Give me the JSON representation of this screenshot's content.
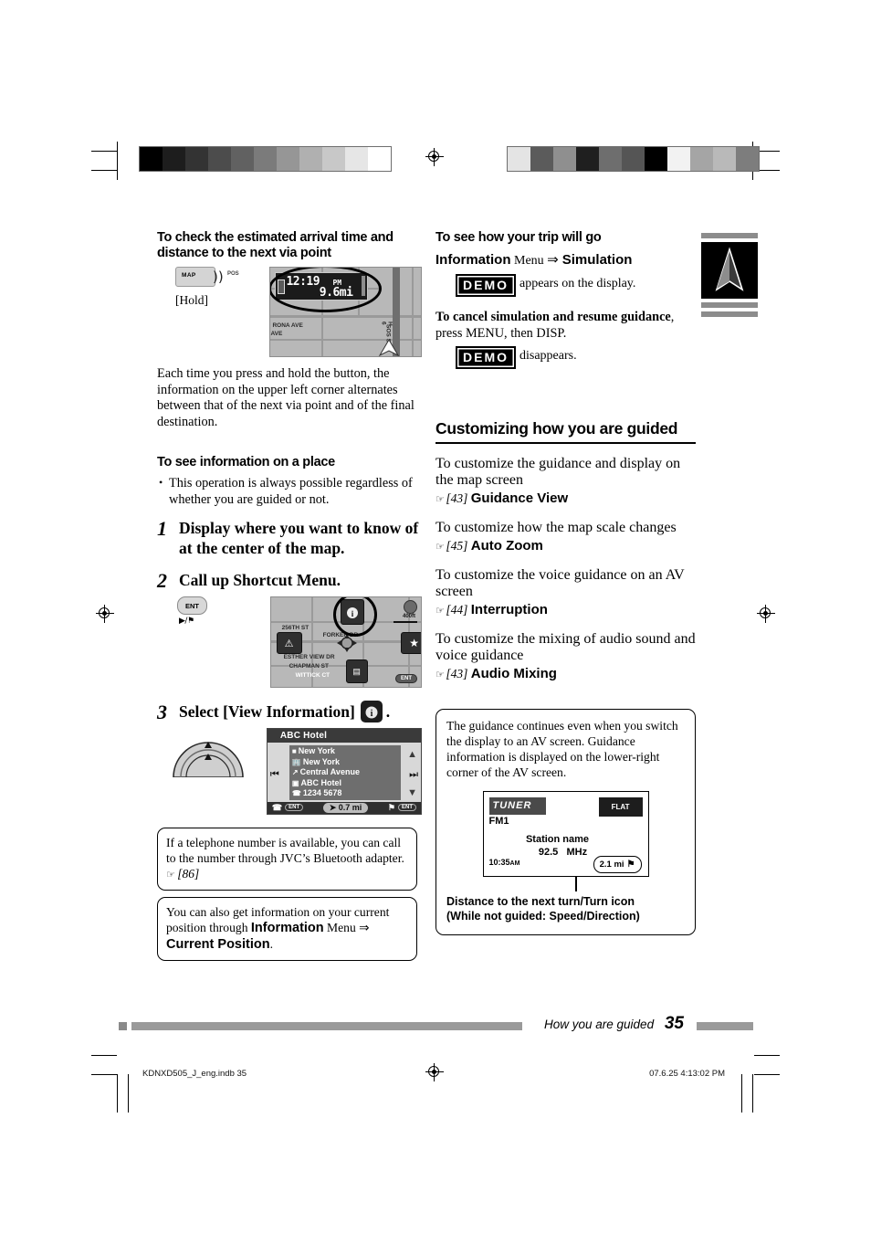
{
  "page": {
    "number": "35",
    "footer_title": "How you are guided",
    "imprint_left": "KDNXD505_J_eng.indb  35",
    "imprint_right": "07.6.25  4:13:02 PM"
  },
  "left_column": {
    "heading1": "To check the estimated arrival time and distance to the next via point",
    "map_button": {
      "label": "MAP",
      "sublabel": "POS",
      "hold": "[Hold]"
    },
    "map_shot_1": {
      "time": "12:19",
      "ampm": "PM",
      "distance": "9.6mi",
      "street_labels": [
        "RONA AVE",
        "AVE",
        "H",
        "6",
        "ST"
      ]
    },
    "paragraph1": "Each time you press and hold the button, the information on the upper left corner alternates between that of the next via point and of the final destination.",
    "heading2": "To see information on a place",
    "bullet1": "This operation is always possible regardless of whether you are guided or not.",
    "step1": {
      "num": "1",
      "text": "Display where you want to know of at the center of the map."
    },
    "step2": {
      "num": "2",
      "text": "Call up Shortcut Menu."
    },
    "ent_button": {
      "label": "ENT",
      "sublabel": "▶/⚑"
    },
    "map_shot_2": {
      "scale": "400ft",
      "street_labels": [
        "256TH ST",
        "FORKER DR",
        "ESTHER VIEW DR",
        "CHAPMAN ST",
        "WITTICK CT",
        "ST"
      ],
      "ent_tag": "ENT"
    },
    "step3": {
      "num": "3",
      "text": "Select [View Information]",
      "trailing": "."
    },
    "hotel_panel": {
      "title": "ABC Hotel",
      "rows": [
        {
          "icon": "flag-icon",
          "text": "New York"
        },
        {
          "icon": "city-icon",
          "text": "New York"
        },
        {
          "icon": "road-icon",
          "text": "Central Avenue"
        },
        {
          "icon": "poi-icon",
          "text": "ABC Hotel"
        },
        {
          "icon": "phone-icon",
          "text": "1234 5678"
        }
      ],
      "distance": "0.7 mi",
      "prev_icon": "skip-previous-icon",
      "next_icon": "skip-next-icon",
      "scroll_up_icon": "chevron-up-icon",
      "scroll_down_icon": "chevron-down-icon",
      "bar_left_icon": "phone-icon",
      "bar_left_tag": "ENT",
      "bar_right_icon": "route-icon",
      "bar_right_tag": "ENT"
    },
    "note1": "If a telephone number is available, you can call to the number through JVC’s Bluetooth adapter.",
    "note1_ref": "[86]",
    "note2_part1": "You can also get information on your current position through ",
    "note2_bold1": "Information",
    "note2_mid": " Menu ",
    "note2_bold2": "Current Position",
    "note2_end": "."
  },
  "right_column": {
    "heading1": "To see how your trip will go",
    "line1_bold1": "Information",
    "line1_mid": " Menu ",
    "line1_bold2": "Simulation",
    "demo_badge": "DEMO",
    "appears_text": "appears on the display.",
    "cancel_bold": "To cancel simulation and resume guidance",
    "cancel_rest": ", press MENU, then DISP.",
    "disappears_text": "disappears.",
    "section_title": "Customizing how you are guided",
    "items": [
      {
        "heading": "To customize the guidance and display on the map screen",
        "ref": "[43]",
        "setting": "Guidance View"
      },
      {
        "heading": "To customize how the map scale changes",
        "ref": "[45]",
        "setting": "Auto Zoom"
      },
      {
        "heading": "To customize the voice guidance on an AV screen",
        "ref": "[44]",
        "setting": "Interruption"
      },
      {
        "heading": "To customize the mixing of audio sound and voice guidance",
        "ref": "[43]",
        "setting": "Audio Mixing"
      }
    ],
    "note": "The guidance continues even when you switch the display to an AV screen. Guidance information is displayed on the lower-right corner of the AV screen.",
    "av_screen": {
      "source": "TUNER",
      "sound_mode": "FLAT",
      "band": "FM1",
      "station_name": "Station name",
      "frequency": "92.5",
      "frequency_unit": "MHz",
      "clock": "10:35",
      "clock_ampm": "AM",
      "distance": "2.1 mi",
      "turn_icon": "turn-right-flag-icon"
    },
    "caption_line1": "Distance to the next turn/Turn icon",
    "caption_line2": "(While not guided: Speed/Direction)"
  },
  "print_marks": {
    "gray_bar_left": [
      "#000000",
      "#1d1d1d",
      "#333333",
      "#4c4c4c",
      "#616161",
      "#7b7b7b",
      "#969696",
      "#b0b0b0",
      "#c8c8c8",
      "#e6e6e6",
      "#ffffff"
    ],
    "gray_bar_right": [
      "#e4e4e4",
      "#5b5b5b",
      "#8f8f8f",
      "#1f1f1f",
      "#6e6e6e",
      "#555555",
      "#000000",
      "#f2f2f2",
      "#a5a5a5",
      "#b9b9b9",
      "#7d7d7d"
    ],
    "nav_tab_icon": "navigation-arrow-icon"
  }
}
